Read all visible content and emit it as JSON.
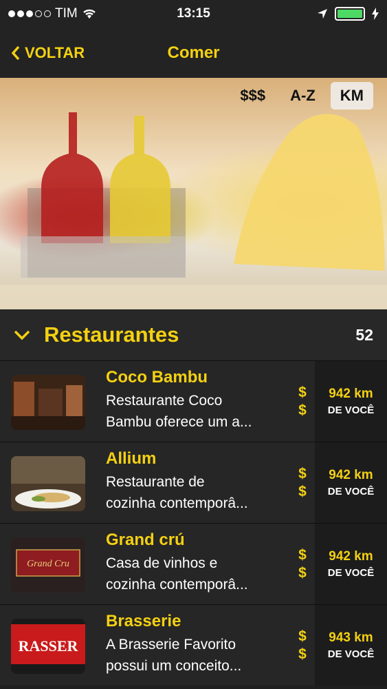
{
  "status_bar": {
    "carrier": "TIM",
    "time": "13:15"
  },
  "nav": {
    "back_label": "VOLTAR",
    "title": "Comer"
  },
  "sort": {
    "price_label": "$$$",
    "alpha_label": "A-Z",
    "distance_label": "KM",
    "active": "KM"
  },
  "section": {
    "title": "Restaurantes",
    "count": "52"
  },
  "restaurants": [
    {
      "name": "Coco Bambu",
      "description": "Restaurante Coco\nBambu oferece um a...",
      "price_line1": "$",
      "price_line2": "$",
      "distance": "942 km",
      "distance_label": "DE VOCÊ"
    },
    {
      "name": "Allium",
      "description": "Restaurante de\ncozinha contemporâ...",
      "price_line1": "$",
      "price_line2": "$",
      "distance": "942 km",
      "distance_label": "DE VOCÊ"
    },
    {
      "name": "Grand crú",
      "description": "Casa de vinhos e\ncozinha contemporâ...",
      "price_line1": "$",
      "price_line2": "$",
      "distance": "942 km",
      "distance_label": "DE VOCÊ"
    },
    {
      "name": "Brasserie",
      "description": "A Brasserie Favorito\npossui um conceito...",
      "price_line1": "$",
      "price_line2": "$",
      "distance": "943 km",
      "distance_label": "DE VOCÊ"
    }
  ],
  "thumbnails": [
    {
      "logo_text": ""
    },
    {
      "logo_text": ""
    },
    {
      "logo_text": "Grand Cru"
    },
    {
      "logo_text": "RASSER"
    }
  ],
  "colors": {
    "accent": "#f4d112",
    "background": "#232323"
  }
}
